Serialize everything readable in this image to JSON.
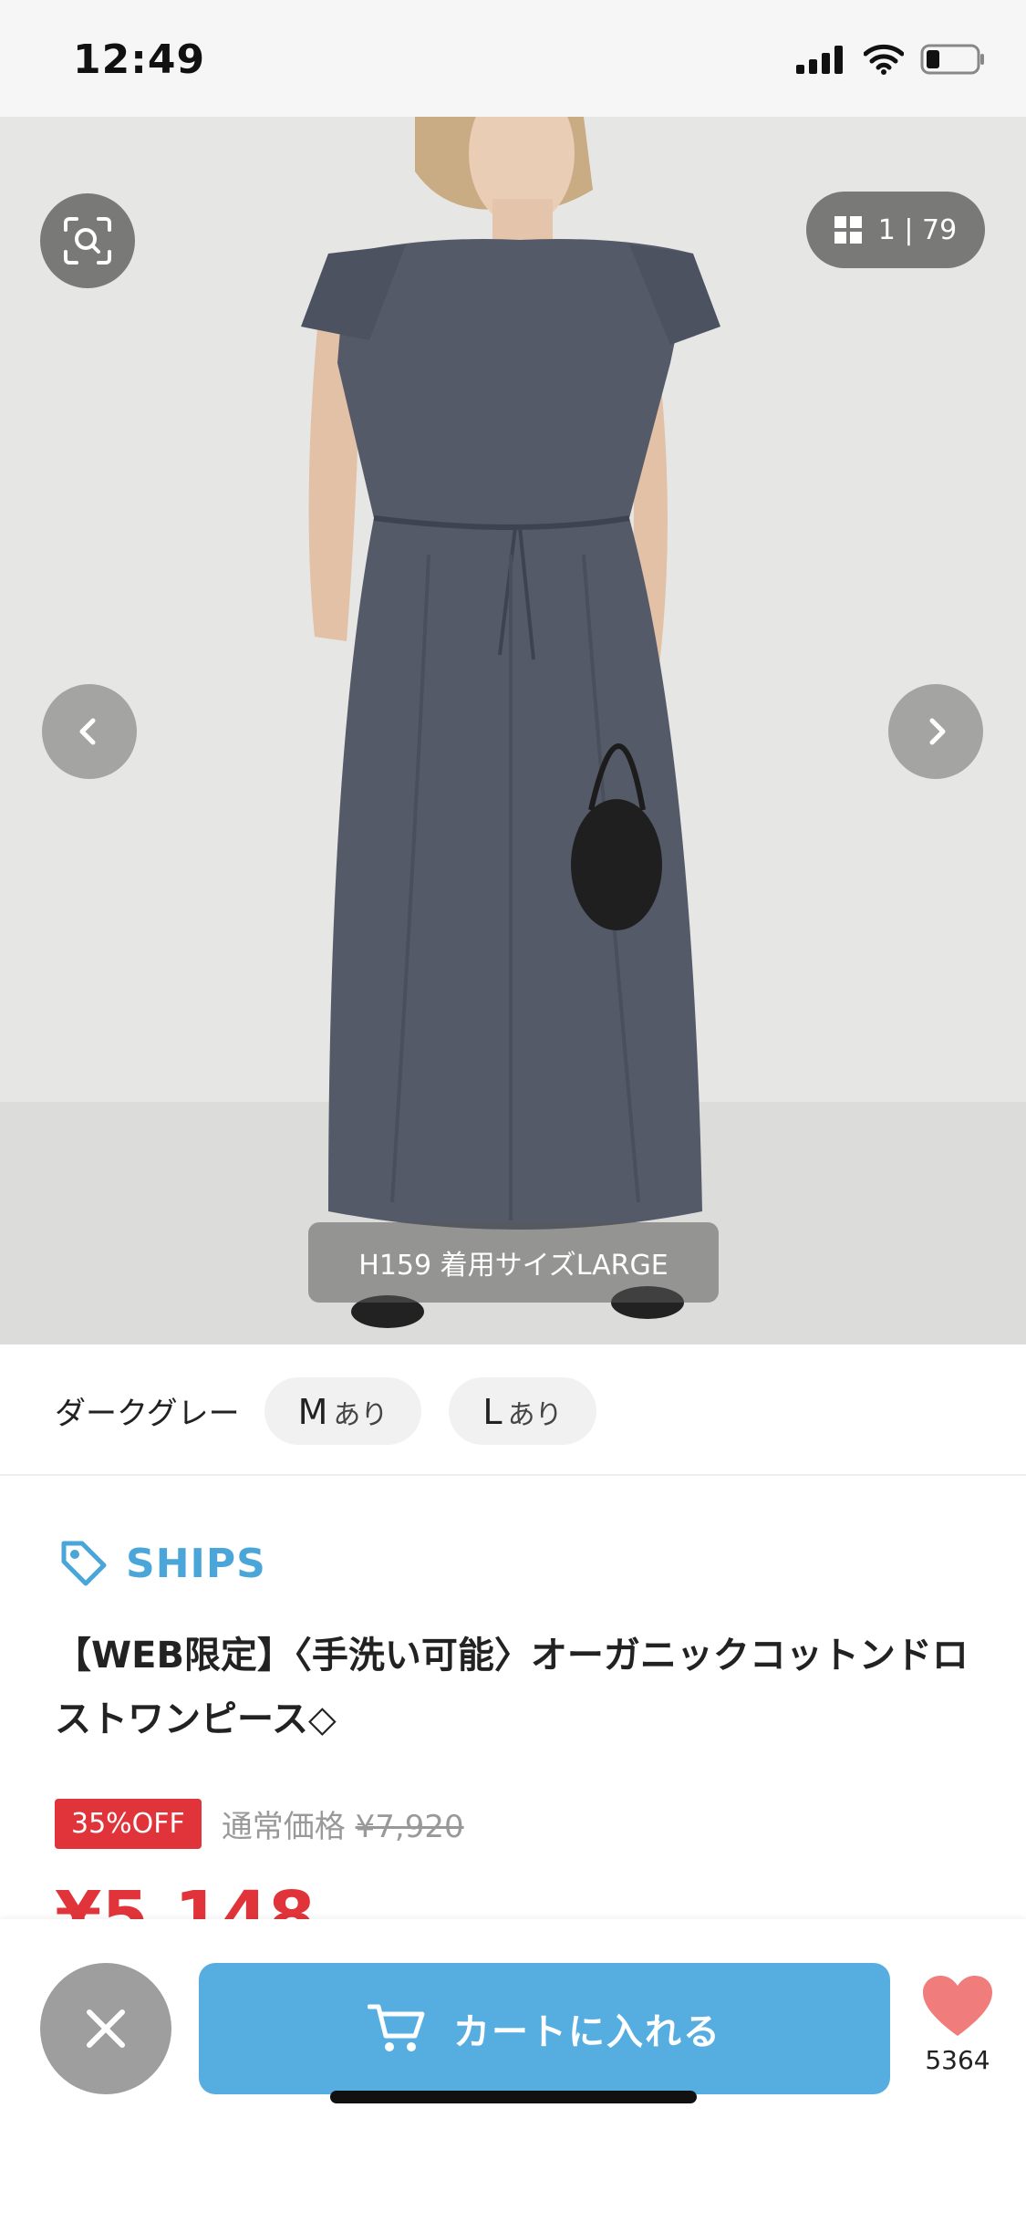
{
  "status_bar": {
    "time": "12:49"
  },
  "gallery": {
    "counter": "1 | 79",
    "caption": "H159 着用サイズLARGE"
  },
  "variants": {
    "color": "ダークグレー",
    "sizes": [
      {
        "size": "M",
        "availability": "あり"
      },
      {
        "size": "L",
        "availability": "あり"
      }
    ]
  },
  "product": {
    "brand": "SHIPS",
    "title": "【WEB限定】〈手洗い可能〉オーガニックコットンドロストワンピース◇",
    "discount": "35%OFF",
    "regular_label": "通常価格",
    "regular_price": "¥7,920",
    "sale_price": "¥5,148"
  },
  "actions": {
    "cart_label": "カートに入れる",
    "like_count": "5364"
  },
  "colors": {
    "accent": "#56aee0",
    "brand": "#4aa6d8",
    "sale": "#e0343a",
    "like": "#f07c7c"
  }
}
